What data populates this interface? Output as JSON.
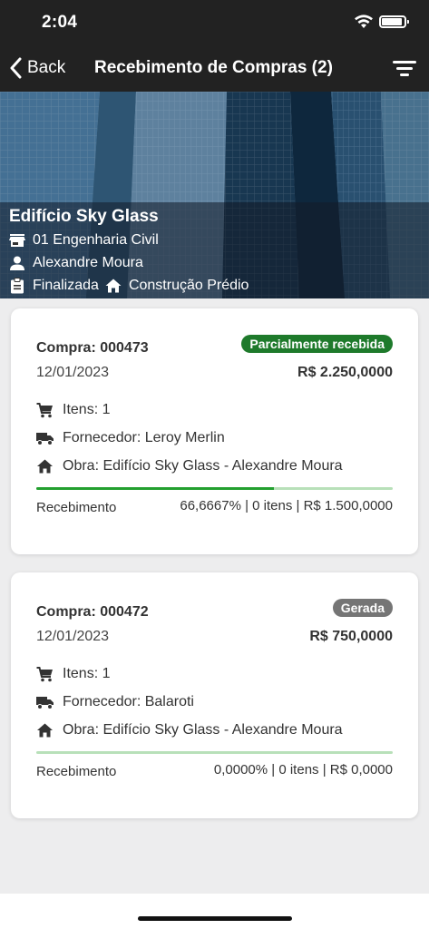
{
  "status_bar": {
    "time": "2:04"
  },
  "nav": {
    "back_label": "Back",
    "title": "Recebimento de Compras (2)"
  },
  "project": {
    "name": "Edifício Sky Glass",
    "company": "01 Engenharia Civil",
    "person": "Alexandre Moura",
    "status": "Finalizada",
    "category": "Construção Prédio"
  },
  "orders": [
    {
      "code": "Compra: 000473",
      "badge": "Parcialmente recebida",
      "badge_color": "#1e7a2b",
      "date": "12/01/2023",
      "amount": "R$ 2.250,0000",
      "items": "Itens: 1",
      "supplier": "Fornecedor: Leroy Merlin",
      "site": "Obra: Edifício Sky Glass - Alexandre Moura",
      "progress": 0.6667,
      "receipt_label": "Recebimento",
      "receipt_value": "66,6667% | 0 itens | R$ 1.500,0000"
    },
    {
      "code": "Compra: 000472",
      "badge": "Gerada",
      "badge_color": "#757575",
      "date": "12/01/2023",
      "amount": "R$ 750,0000",
      "items": "Itens: 1",
      "supplier": "Fornecedor: Balaroti",
      "site": "Obra: Edifício Sky Glass - Alexandre Moura",
      "progress": 0.0,
      "receipt_label": "Recebimento",
      "receipt_value": "0,0000% | 0 itens | R$ 0,0000"
    }
  ]
}
